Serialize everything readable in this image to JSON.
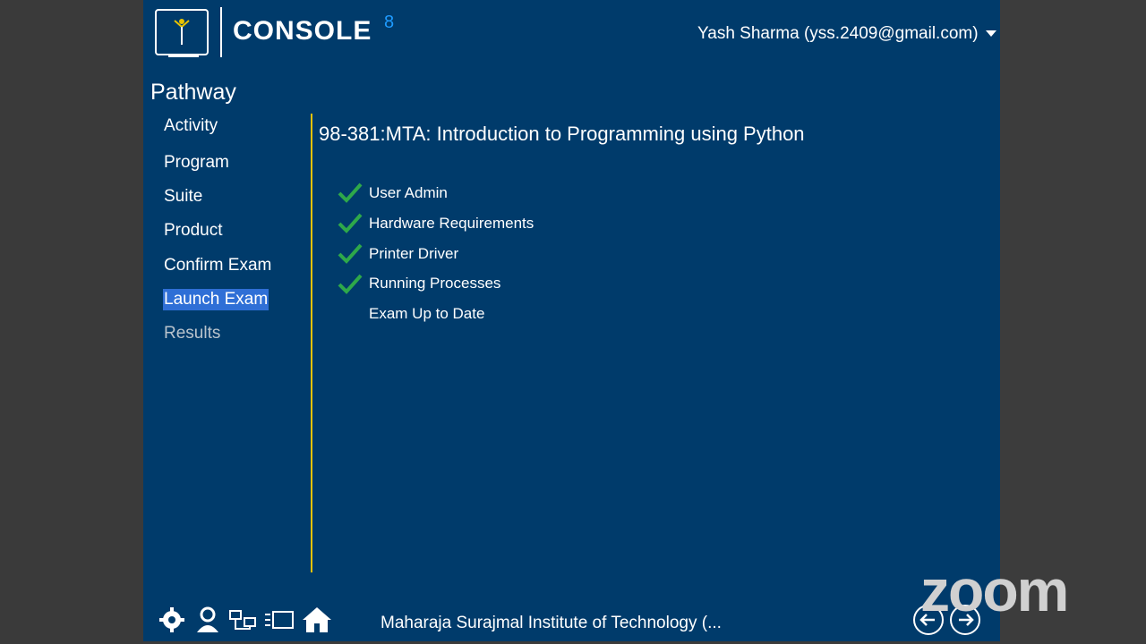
{
  "brand": {
    "name": "CONSOLE",
    "superscript": "8"
  },
  "user": {
    "label": "Yash Sharma (yss.2409@gmail.com)"
  },
  "sidebar": {
    "title": "Pathway",
    "items": [
      {
        "label": "Activity",
        "state": "normal"
      },
      {
        "label": "Program",
        "state": "normal"
      },
      {
        "label": "Suite",
        "state": "normal"
      },
      {
        "label": "Product",
        "state": "normal"
      },
      {
        "label": "Confirm Exam",
        "state": "normal"
      },
      {
        "label": "Launch Exam",
        "state": "active"
      },
      {
        "label": "Results",
        "state": "disabled"
      }
    ]
  },
  "main": {
    "title": "98-381:MTA: Introduction to Programming using Python",
    "tasks": [
      {
        "label": "User Admin",
        "done": true
      },
      {
        "label": "Hardware Requirements",
        "done": true
      },
      {
        "label": "Printer Driver",
        "done": true
      },
      {
        "label": "Running Processes",
        "done": true
      },
      {
        "label": "Exam Up to Date",
        "done": false
      }
    ]
  },
  "footer": {
    "institution": "Maharaja Surajmal Institute of Technology (...",
    "icons": [
      "gear-icon",
      "user-badge-icon",
      "network-icon",
      "list-screen-icon",
      "home-icon"
    ],
    "nav": [
      "back-arrow-icon",
      "forward-arrow-icon"
    ]
  },
  "overlay": {
    "watermark": "zoom"
  },
  "colors": {
    "background": "#003b6b",
    "accent": "#e8c200",
    "check": "#2ea84a",
    "brand_superscript": "#1e9bff"
  }
}
